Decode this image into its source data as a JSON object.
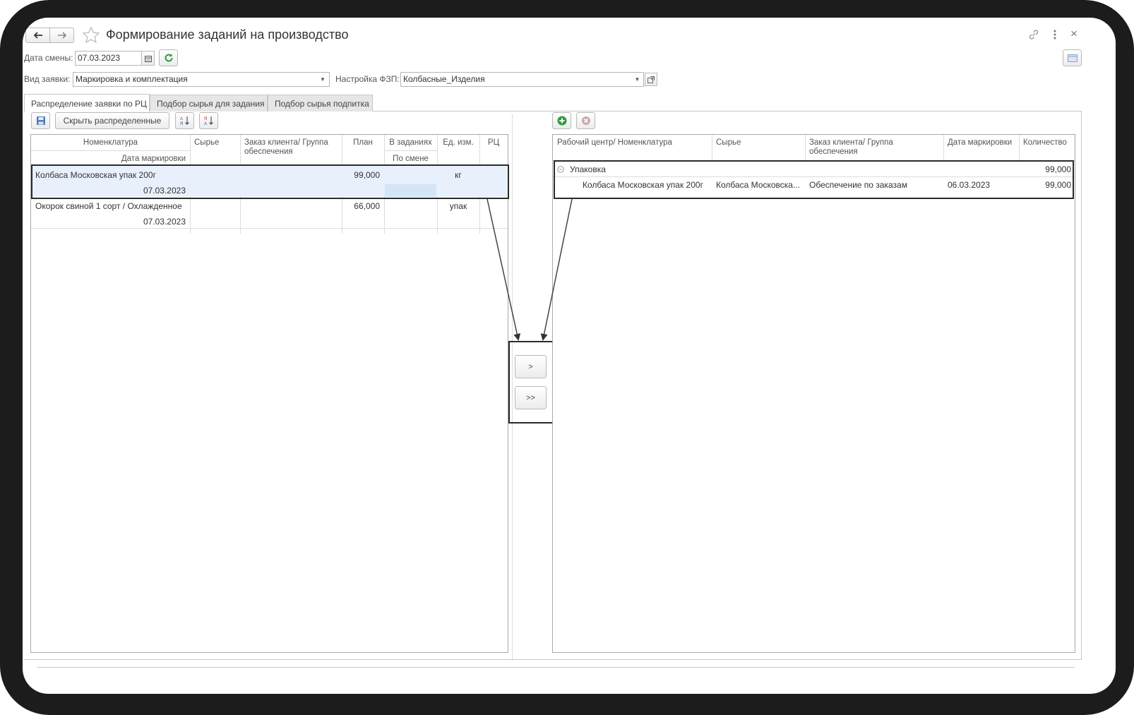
{
  "window": {
    "title": "Формирование заданий на производство",
    "back_icon": "arrow-left-icon",
    "forward_icon": "arrow-right-icon",
    "favorite_icon": "star-icon",
    "link_icon": "link-icon",
    "more_icon": "more-vertical-icon",
    "close_label": "×"
  },
  "filters": {
    "shift_date_label": "Дата смены:",
    "shift_date_value": "07.03.2023",
    "request_type_label": "Вид заявки:",
    "request_type_value": "Маркировка и комплектация",
    "fzp_setting_label": "Настройка ФЗП:",
    "fzp_setting_value": "Колбасные_Изделия"
  },
  "tabs": [
    {
      "label": "Распределение заявки по РЦ",
      "active": true
    },
    {
      "label": "Подбор сырья для задания",
      "active": false
    },
    {
      "label": "Подбор сырья подпитка",
      "active": false
    }
  ],
  "left_toolbar": {
    "hide_distributed_label": "Скрыть распределенные"
  },
  "left_table": {
    "headers": {
      "nomenclature": "Номенклатура",
      "marking_date": "Дата маркировки",
      "raw": "Сырье",
      "order": "Заказ клиента/ Группа обеспечения",
      "plan": "План",
      "in_tasks": "В заданиях",
      "per_shift": "По смене",
      "unit": "Ед. изм.",
      "rc": "РЦ"
    },
    "rows": [
      {
        "nomenclature": "Колбаса Московская упак 200г",
        "marking_date": "07.03.2023",
        "raw": "",
        "order": "",
        "plan": "99,000",
        "in_tasks": "",
        "unit": "кг",
        "rc": ""
      },
      {
        "nomenclature": "Окорок свиной 1 сорт / Охлажденное",
        "marking_date": "07.03.2023",
        "raw": "",
        "order": "",
        "plan": "66,000",
        "in_tasks": "",
        "unit": "упак",
        "rc": ""
      }
    ]
  },
  "move_buttons": {
    "move_one": ">",
    "move_all": ">>"
  },
  "right_table": {
    "headers": {
      "workcenter": "Рабочий центр/ Номенклатура",
      "raw": "Сырье",
      "order": "Заказ клиента/ Группа обеспечения",
      "marking_date": "Дата маркировки",
      "quantity": "Количество"
    },
    "group": {
      "name": "Упаковка",
      "quantity": "99,000",
      "collapse_icon": "minus-circle-icon"
    },
    "rows": [
      {
        "nomenclature": "Колбаса Московская упак 200г",
        "raw": "Колбаса Московска...",
        "order": "Обеспечение по заказам",
        "marking_date": "06.03.2023",
        "quantity": "99,000"
      }
    ]
  },
  "colors": {
    "selection": "#e8f1fb",
    "highlight_border": "#2a2a2a",
    "refresh_green": "#2e9c3a",
    "add_green": "#2e9c3a"
  }
}
